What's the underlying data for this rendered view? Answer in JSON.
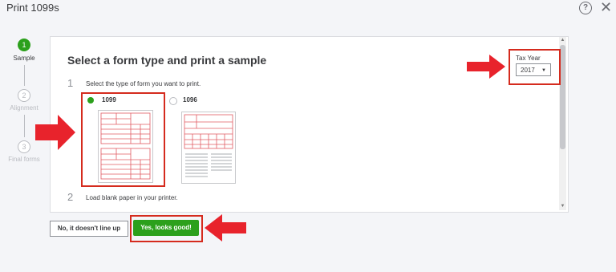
{
  "window": {
    "title": "Print 1099s",
    "help_icon": "?",
    "close_icon": "✕"
  },
  "stepper": {
    "steps": [
      {
        "number": "1",
        "label": "Sample",
        "state": "active"
      },
      {
        "number": "2",
        "label": "Alignment",
        "state": "inactive"
      },
      {
        "number": "3",
        "label": "Final forms",
        "state": "inactive"
      }
    ]
  },
  "main": {
    "heading": "Select a form type and print a sample",
    "step1": {
      "number": "1",
      "text": "Select the type of form you want to print."
    },
    "step2": {
      "number": "2",
      "text": "Load blank paper in your printer."
    },
    "form_options": [
      {
        "label": "1099",
        "selected": true
      },
      {
        "label": "1096",
        "selected": false
      }
    ]
  },
  "tax_year": {
    "label": "Tax Year",
    "value": "2017"
  },
  "buttons": {
    "secondary": "No, it doesn't line up",
    "primary": "Yes, looks good!"
  },
  "colors": {
    "accent": "#2ca01c",
    "highlight": "#d52b1e"
  }
}
